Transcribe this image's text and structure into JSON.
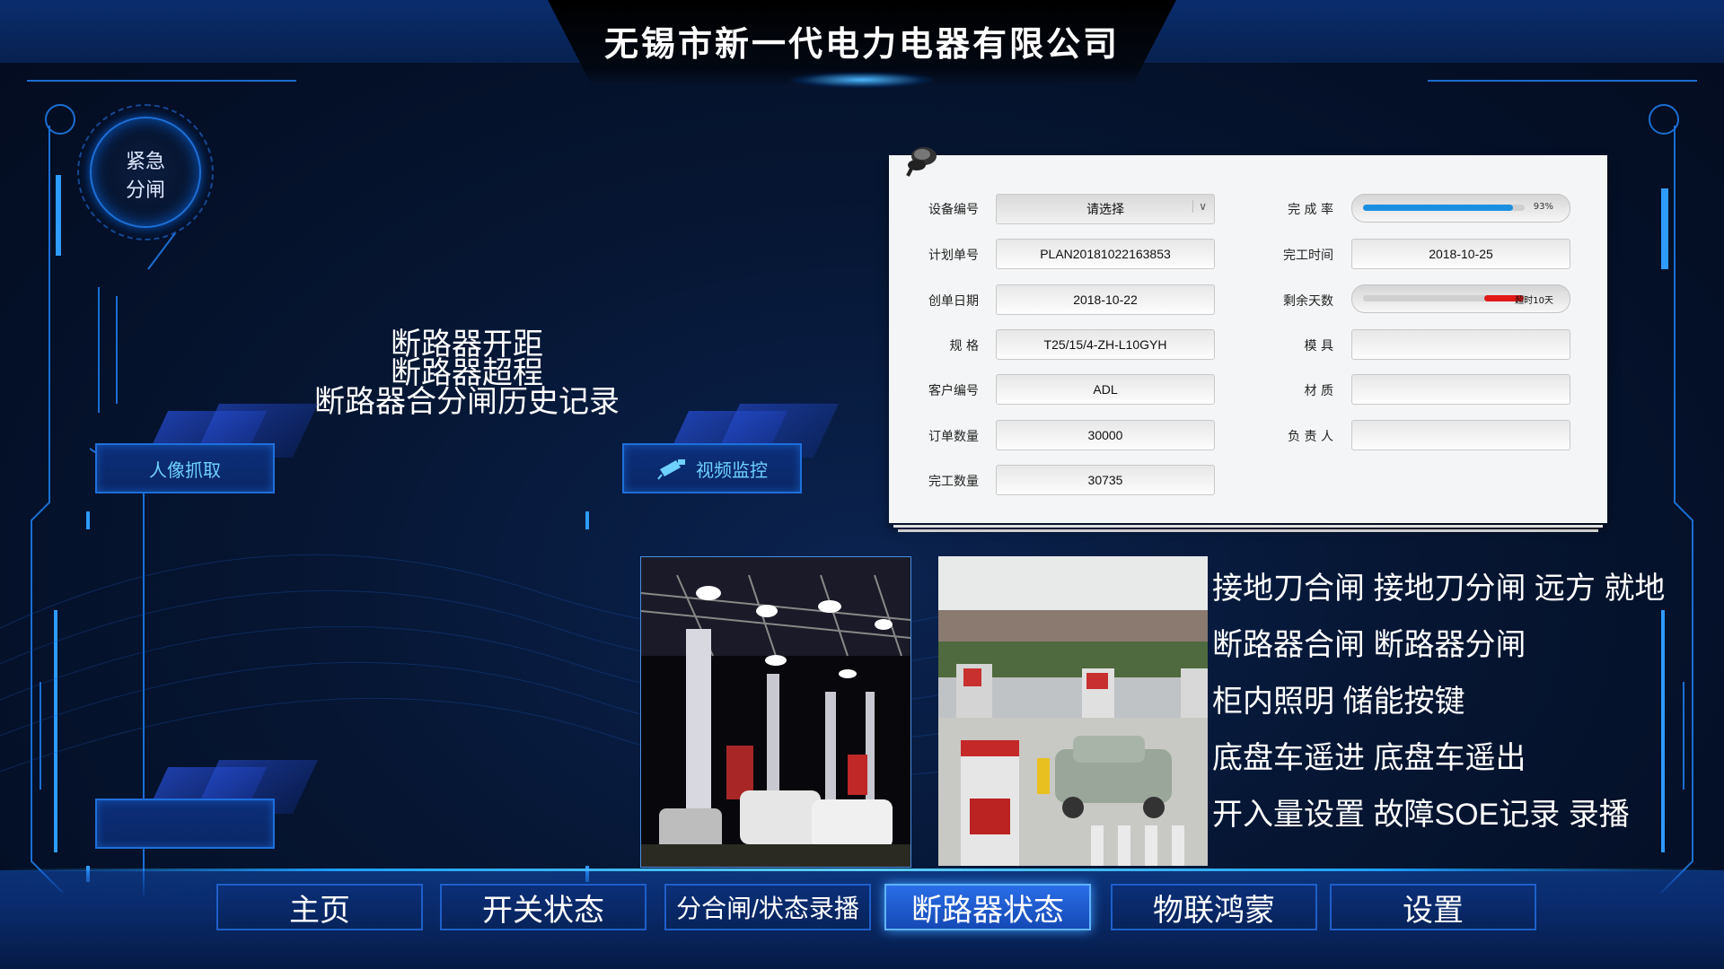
{
  "header": {
    "title": "无锡市新一代电力电器有限公司"
  },
  "emergency": {
    "line1": "紧急",
    "line2": "分闸"
  },
  "breaker_text": {
    "line1": "断路器开距",
    "line2": "断路器超程",
    "line3": "断路器合分闸历史记录"
  },
  "buttons": {
    "face_capture": "人像抓取",
    "video_monitor": "视频监控"
  },
  "panel": {
    "device_no": {
      "label": "设备编号",
      "value": "请选择"
    },
    "plan_no": {
      "label": "计划单号",
      "value": "PLAN20181022163853"
    },
    "create_date": {
      "label": "创单日期",
      "value": "2018-10-22"
    },
    "spec": {
      "label": "规 格",
      "value": "T25/15/4-ZH-L10GYH"
    },
    "customer_no": {
      "label": "客户编号",
      "value": "ADL"
    },
    "order_qty": {
      "label": "订单数量",
      "value": "30000"
    },
    "done_qty": {
      "label": "完工数量",
      "value": "30735"
    },
    "completion_rate": {
      "label": "完 成 率",
      "value_text": "93%",
      "value": 0.93
    },
    "done_time": {
      "label": "完工时间",
      "value": "2018-10-25"
    },
    "remaining_days": {
      "label": "剩余天数",
      "value_text": "超时10天"
    },
    "mold": {
      "label": "模 具",
      "value": ""
    },
    "material": {
      "label": "材 质",
      "value": ""
    },
    "owner": {
      "label": "负 责 人",
      "value": ""
    }
  },
  "right_text": {
    "line1": "接地刀合闸 接地刀分闸 远方 就地",
    "line2": "断路器合闸 断路器分闸",
    "line3": "柜内照明 储能按键",
    "line4": "底盘车遥进 底盘车遥出",
    "line5": "开入量设置 故障SOE记录 录播"
  },
  "nav": {
    "tabs": [
      {
        "label": "主页"
      },
      {
        "label": "开关状态"
      },
      {
        "label": "分合闸/状态录播"
      },
      {
        "label": "断路器状态"
      },
      {
        "label": "物联鸿蒙"
      },
      {
        "label": "设置"
      }
    ],
    "active_index": 3
  },
  "colors": {
    "accent": "#1e7ff0",
    "progress_blue": "#1a8fe0",
    "progress_red": "#e01818"
  }
}
